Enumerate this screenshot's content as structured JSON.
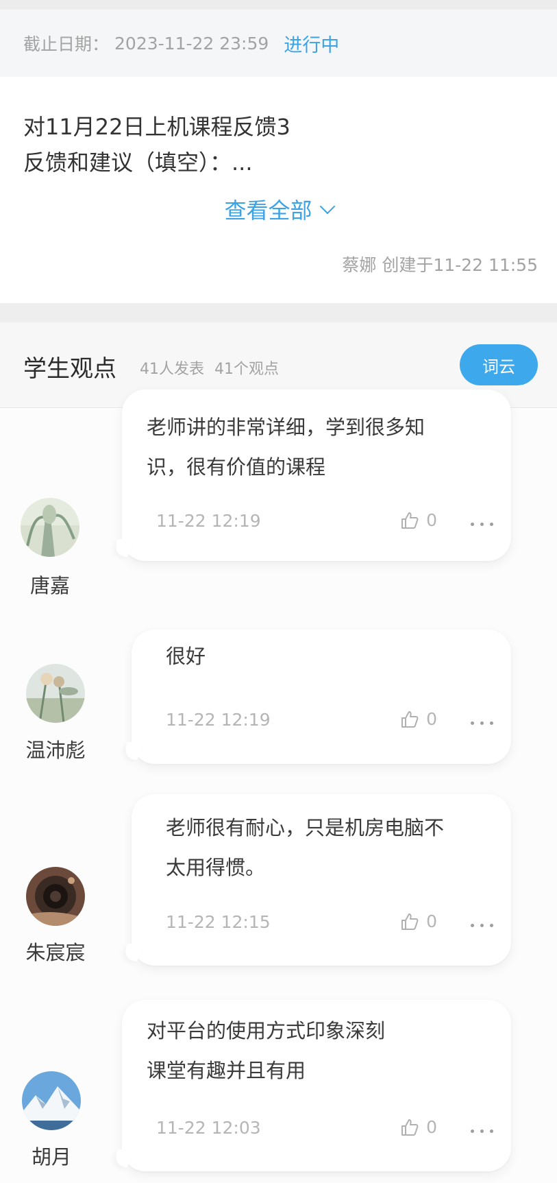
{
  "task": {
    "deadline_label": "截止日期：",
    "deadline_date": "2023-11-22 23:59",
    "status": "进行中",
    "title_line1": "对11月22日上机课程反馈3",
    "title_line2": "反馈和建议（填空）：...",
    "view_all": "查看全部",
    "creator_line": "蔡娜 创建于11-22 11:55"
  },
  "section": {
    "title": "学生观点",
    "participants": "41人发表",
    "opinions": "41个观点",
    "wordcloud_label": "词云"
  },
  "colors": {
    "accent": "#3ba2e6",
    "button": "#3da9ec",
    "text_primary": "#333333",
    "text_muted": "#a3a3a3"
  },
  "posts": [
    {
      "author": "唐嘉",
      "line1": "老师讲的非常详细，学到很多知",
      "line2": "识，很有价值的课程",
      "time": "11-22 12:19",
      "likes": "0",
      "avatar_icon": "plant-photo-avatar-icon"
    },
    {
      "author": "温沛彪",
      "line1": "很好",
      "line2": "",
      "time": "11-22 12:19",
      "likes": "0",
      "avatar_icon": "flower-photo-avatar-icon"
    },
    {
      "author": "朱宸宸",
      "line1": "老师很有耐心，只是机房电脑不",
      "line2": "太用得惯。",
      "time": "11-22 12:15",
      "likes": "0",
      "avatar_icon": "camera-photo-avatar-icon"
    },
    {
      "author": "胡月",
      "line1": "对平台的使用方式印象深刻",
      "line2": "课堂有趣并且有用",
      "time": "11-22 12:03",
      "likes": "0",
      "avatar_icon": "mountain-photo-avatar-icon"
    }
  ]
}
